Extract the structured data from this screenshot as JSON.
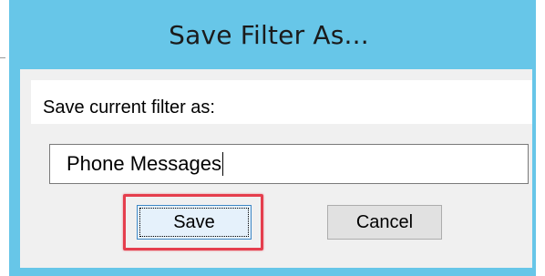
{
  "dialog": {
    "title": "Save Filter As...",
    "prompt_label": "Save current filter as:",
    "filter_name_value": "Phone Messages",
    "save_label": "Save",
    "cancel_label": "Cancel"
  },
  "colors": {
    "titlebar": "#67c6e8",
    "client": "#f0f0f0",
    "highlight": "#e53e4d",
    "focused_button_border": "#3f88c5"
  }
}
